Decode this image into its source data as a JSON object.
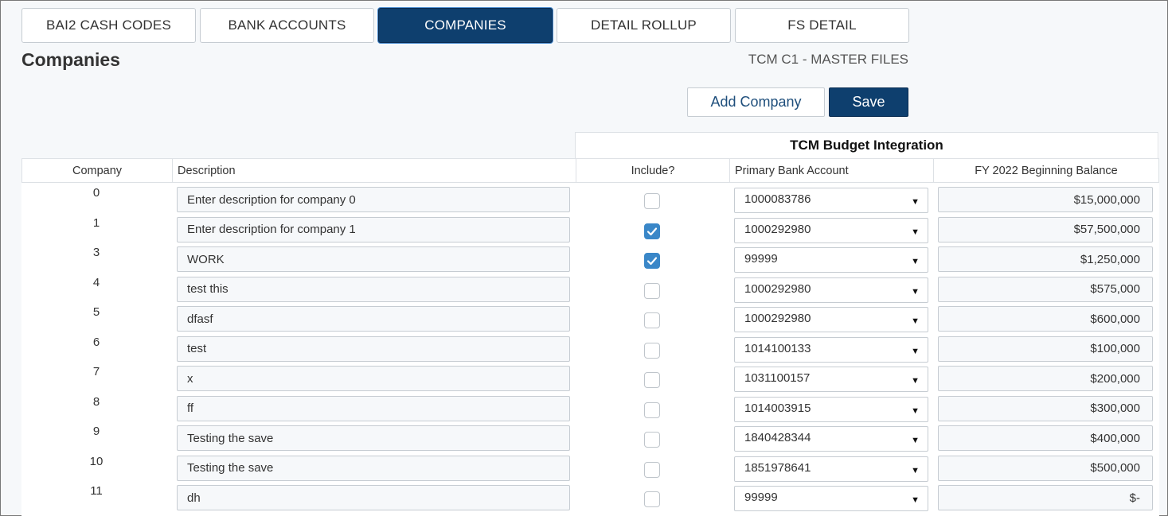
{
  "tabs": [
    {
      "label": "BAI2 CASH CODES",
      "active": false
    },
    {
      "label": "BANK ACCOUNTS",
      "active": false
    },
    {
      "label": "COMPANIES",
      "active": true
    },
    {
      "label": "DETAIL ROLLUP",
      "active": false
    },
    {
      "label": "FS DETAIL",
      "active": false
    }
  ],
  "page": {
    "title": "Companies",
    "subtitle": "TCM C1 - MASTER FILES"
  },
  "actions": {
    "add_label": "Add Company",
    "save_label": "Save"
  },
  "grid": {
    "group_header": "TCM Budget Integration",
    "columns": [
      "Company",
      "Description",
      "Include?",
      "Primary Bank Account",
      "FY 2022 Beginning Balance"
    ],
    "rows": [
      {
        "company": "0",
        "description": "Enter description for company 0",
        "include": false,
        "bank": "1000083786",
        "balance": "$15,000,000"
      },
      {
        "company": "1",
        "description": "Enter description for company 1",
        "include": true,
        "bank": "1000292980",
        "balance": "$57,500,000"
      },
      {
        "company": "3",
        "description": "WORK",
        "include": true,
        "bank": "99999",
        "balance": "$1,250,000"
      },
      {
        "company": "4",
        "description": "test this",
        "include": false,
        "bank": "1000292980",
        "balance": "$575,000"
      },
      {
        "company": "5",
        "description": "dfasf",
        "include": false,
        "bank": "1000292980",
        "balance": "$600,000"
      },
      {
        "company": "6",
        "description": "test",
        "include": false,
        "bank": "1014100133",
        "balance": "$100,000"
      },
      {
        "company": "7",
        "description": "x",
        "include": false,
        "bank": "1031100157",
        "balance": "$200,000"
      },
      {
        "company": "8",
        "description": "ff",
        "include": false,
        "bank": "1014003915",
        "balance": "$300,000"
      },
      {
        "company": "9",
        "description": "Testing the save",
        "include": false,
        "bank": "1840428344",
        "balance": "$400,000"
      },
      {
        "company": "10",
        "description": "Testing the save",
        "include": false,
        "bank": "1851978641",
        "balance": "$500,000"
      },
      {
        "company": "11",
        "description": "dh",
        "include": false,
        "bank": "99999",
        "balance": "$-"
      }
    ]
  },
  "colors": {
    "accent": "#0e3f6e",
    "checkbox_on": "#3a87c8"
  }
}
